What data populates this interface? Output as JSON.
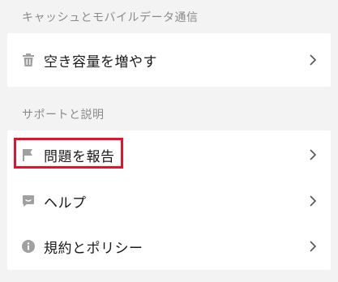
{
  "sections": {
    "cache": {
      "header": "キャッシュとモバイルデータ通信",
      "items": [
        {
          "label": "空き容量を増やす",
          "icon": "trash-icon"
        }
      ]
    },
    "support": {
      "header": "サポートと説明",
      "items": [
        {
          "label": "問題を報告",
          "icon": "flag-icon"
        },
        {
          "label": "ヘルプ",
          "icon": "chat-bubble-icon"
        },
        {
          "label": "規約とポリシー",
          "icon": "info-icon"
        }
      ]
    }
  },
  "colors": {
    "background": "#f3f3f3",
    "card": "#ffffff",
    "icon": "#a0a0a0",
    "highlight": "#e8102a"
  }
}
